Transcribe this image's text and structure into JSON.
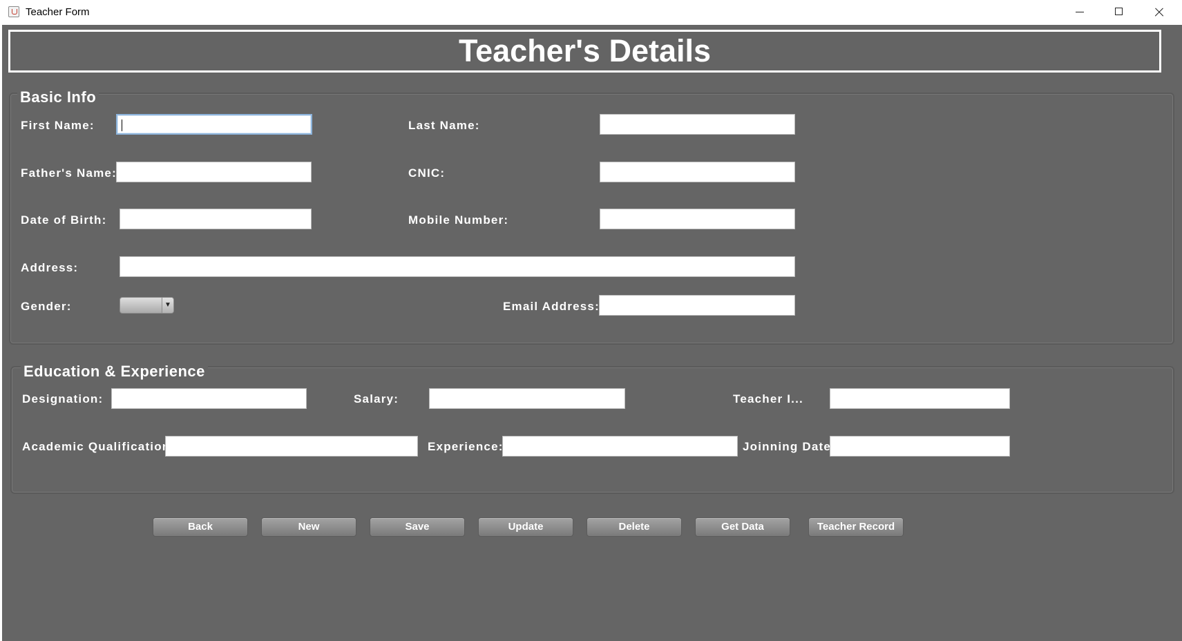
{
  "window": {
    "title": "Teacher Form",
    "controls": [
      "minimize",
      "maximize",
      "close"
    ]
  },
  "header": {
    "title": "Teacher's Details"
  },
  "basic_info": {
    "legend": "Basic Info",
    "first_name": {
      "label": "First Name:",
      "value": ""
    },
    "last_name": {
      "label": "Last Name:",
      "value": ""
    },
    "fathers_name": {
      "label": "Father's Name:",
      "value": ""
    },
    "cnic": {
      "label": "CNIC:",
      "value": ""
    },
    "date_of_birth": {
      "label": "Date of Birth:",
      "value": ""
    },
    "mobile_number": {
      "label": "Mobile Number:",
      "value": ""
    },
    "address": {
      "label": "Address:",
      "value": ""
    },
    "gender": {
      "label": "Gender:",
      "selected": ""
    },
    "email_address": {
      "label": "Email Address:",
      "value": ""
    }
  },
  "education": {
    "legend": "Education & Experience",
    "designation": {
      "label": "Designation:",
      "value": ""
    },
    "salary": {
      "label": "Salary:",
      "value": ""
    },
    "teacher_id": {
      "label": "Teacher I...",
      "value": ""
    },
    "academic_qualification": {
      "label": "Academic Qualification:",
      "value": ""
    },
    "experience": {
      "label": "Experience:",
      "value": ""
    },
    "joining_date": {
      "label": "Joinning Date:",
      "value": ""
    }
  },
  "buttons": {
    "back": "Back",
    "new": "New",
    "save": "Save",
    "update": "Update",
    "delete": "Delete",
    "get_data": "Get Data",
    "teacher_record": "Teacher Record"
  },
  "colors": {
    "background": "#656565",
    "text": "#ffffff",
    "field": "#ffffff",
    "focus_border": "#8db4dc"
  }
}
